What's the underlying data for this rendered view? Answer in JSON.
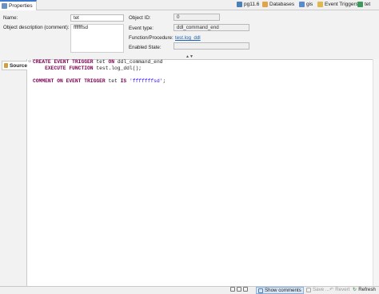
{
  "tabs": {
    "properties": "Properties"
  },
  "breadcrumb": [
    "pg11.6",
    "Databases",
    "gis",
    "Event Triggers",
    "tet"
  ],
  "form": {
    "name_label": "Name:",
    "name_value": "tet",
    "desc_label": "Object description (comment):",
    "desc_value": "fffffffsd",
    "id_label": "Object ID:",
    "id_value": "0",
    "event_type_label": "Event type:",
    "event_type_value": "ddl_command_end",
    "function_label": "Function/Procedure:",
    "function_value": "test.log_ddl",
    "enabled_label": "Enabled State:",
    "enabled_value": ""
  },
  "editor": {
    "side_tab": "Source",
    "lines": [
      {
        "a": "CREATE EVENT TRIGGER",
        "b": " tet ",
        "c": "ON",
        "d": " ddl_command_end"
      },
      {
        "a": "    EXECUTE FUNCTION",
        "b": " test.log_ddl();",
        "c": "",
        "d": ""
      },
      {
        "a": "",
        "b": "",
        "c": "",
        "d": ""
      },
      {
        "a": "COMMENT ON EVENT TRIGGER",
        "b": " tet ",
        "c": "IS",
        "d": "",
        "s": "'fffffffsd'",
        "e": ";"
      }
    ]
  },
  "statusbar": {
    "show_comments": "Show comments",
    "save": "Save ...",
    "revert": "Revert",
    "refresh": "Refresh"
  },
  "colors": {
    "accent": "#3c78c8",
    "keyword": "#7f0055",
    "string": "#2a00ff",
    "link": "#1a5fb4"
  }
}
